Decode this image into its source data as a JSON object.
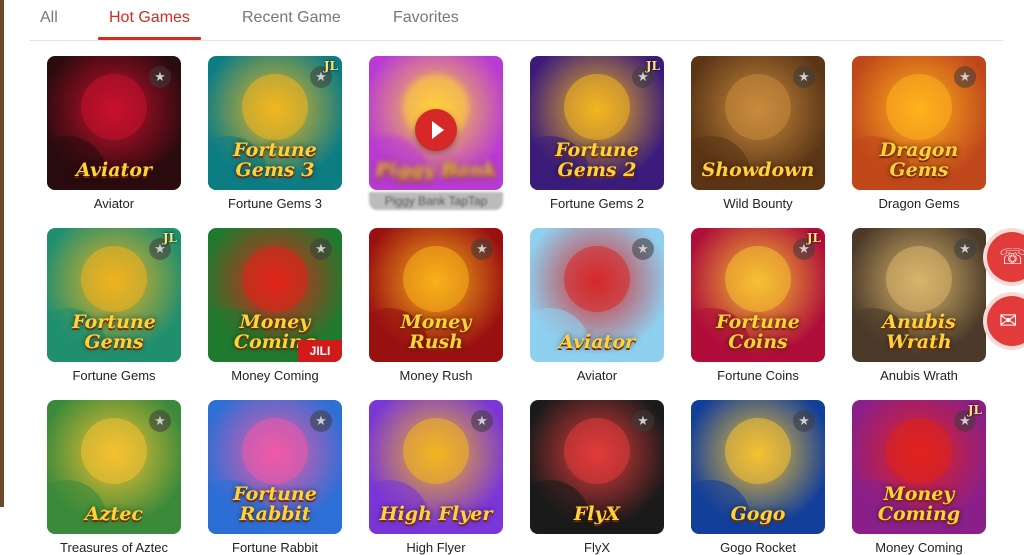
{
  "tabs": [
    {
      "label": "All",
      "active": false
    },
    {
      "label": "Hot Games",
      "active": true
    },
    {
      "label": "Recent Game",
      "active": false
    },
    {
      "label": "Favorites",
      "active": false
    }
  ],
  "games": [
    {
      "name": "Aviator",
      "art": "Aviator",
      "bg": "#2a0b0e",
      "accent": "#c8102e",
      "jl": false
    },
    {
      "name": "Fortune Gems 3",
      "art": "Fortune Gems 3",
      "bg": "#0d7d84",
      "accent": "#f2b61f",
      "jl": true
    },
    {
      "name": "Piggy Bank TapTap",
      "art": "Piggy Bank",
      "bg": "#b93bd3",
      "accent": "#ffd23a",
      "jl": false
    },
    {
      "name": "Fortune Gems 2",
      "art": "Fortune Gems 2",
      "bg": "#3b1c7a",
      "accent": "#f2b61f",
      "jl": true
    },
    {
      "name": "Wild Bounty",
      "art": "Showdown",
      "bg": "#5a3516",
      "accent": "#c98a3c",
      "jl": false
    },
    {
      "name": "Dragon Gems",
      "art": "Dragon Gems",
      "bg": "#c0471b",
      "accent": "#ffb21e",
      "jl": false
    },
    {
      "name": "Fortune Gems",
      "art": "Fortune Gems",
      "bg": "#1f8f6e",
      "accent": "#f0b21f",
      "jl": true
    },
    {
      "name": "Money Coming",
      "art": "Money Coming",
      "bg": "#1f7a2e",
      "accent": "#e2231a",
      "jl": false
    },
    {
      "name": "Money Rush",
      "art": "Money Rush",
      "bg": "#9a1010",
      "accent": "#f7b11a",
      "jl": false
    },
    {
      "name": "Aviator",
      "art": "Aviator",
      "bg": "#8fd0f0",
      "accent": "#d62828",
      "jl": false
    },
    {
      "name": "Fortune Coins",
      "art": "Fortune Coins",
      "bg": "#b00e3a",
      "accent": "#f5c132",
      "jl": true
    },
    {
      "name": "Anubis Wrath",
      "art": "Anubis Wrath",
      "bg": "#4b3a2a",
      "accent": "#d9b56a",
      "jl": false
    },
    {
      "name": "Treasures of Aztec",
      "art": "Aztec",
      "bg": "#3a8a3a",
      "accent": "#f5c132",
      "jl": false
    },
    {
      "name": "Fortune Rabbit",
      "art": "Fortune Rabbit",
      "bg": "#2c6fd6",
      "accent": "#f05aa8",
      "jl": false
    },
    {
      "name": "High Flyer",
      "art": "High Flyer",
      "bg": "#7a36d6",
      "accent": "#f2b61f",
      "jl": false
    },
    {
      "name": "FlyX",
      "art": "FlyX",
      "bg": "#1a1a1a",
      "accent": "#e23b3b",
      "jl": false
    },
    {
      "name": "Gogo Rocket",
      "art": "Gogo",
      "bg": "#123f9a",
      "accent": "#f5c132",
      "jl": false
    },
    {
      "name": "Money Coming",
      "art": "Money Coming",
      "bg": "#8a1f8a",
      "accent": "#e2231a",
      "jl": true
    }
  ],
  "badges": {
    "jl": "JL",
    "jili": "JILI"
  },
  "floating": [
    {
      "icon": "headset-icon"
    },
    {
      "icon": "mail-icon"
    }
  ]
}
